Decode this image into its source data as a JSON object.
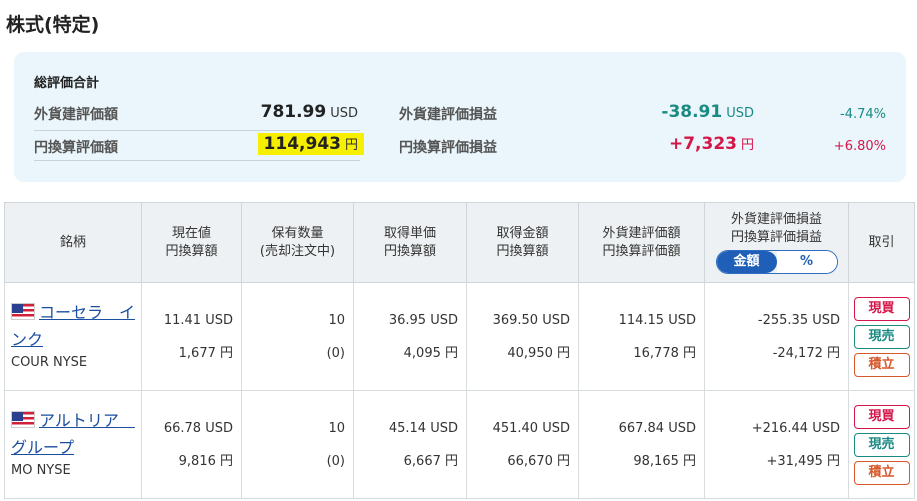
{
  "page_title": "株式(特定)",
  "summary": {
    "heading": "総評価合計",
    "foreign_value_label": "外貨建評価額",
    "foreign_value": "781.99",
    "foreign_value_unit": "USD",
    "yen_value_label": "円換算評価額",
    "yen_value": "114,943",
    "yen_value_unit": "円",
    "foreign_pl_label": "外貨建評価損益",
    "foreign_pl": "-38.91",
    "foreign_pl_unit": "USD",
    "foreign_pl_pct": "-4.74%",
    "yen_pl_label": "円換算評価損益",
    "yen_pl": "+7,323",
    "yen_pl_unit": "円",
    "yen_pl_pct": "+6.80%"
  },
  "table": {
    "headers": {
      "name": "銘柄",
      "price_1": "現在値",
      "price_2": "円換算額",
      "qty_1": "保有数量",
      "qty_2": "(売却注文中)",
      "unit_cost_1": "取得単価",
      "unit_cost_2": "円換算額",
      "cost_1": "取得金額",
      "cost_2": "円換算額",
      "value_1": "外貨建評価額",
      "value_2": "円換算評価額",
      "pl_1": "外貨建評価損益",
      "pl_2": "円換算評価損益",
      "toggle_amount": "金額",
      "toggle_pct": "%",
      "trade": "取引"
    },
    "rows": [
      {
        "name": "コーセラ　インク",
        "code": "COUR NYSE",
        "price_usd": "11.41 USD",
        "price_jpy": "1,677 円",
        "qty": "10",
        "qty_selling": "(0)",
        "unit_cost_usd": "36.95 USD",
        "unit_cost_jpy": "4,095 円",
        "cost_usd": "369.50 USD",
        "cost_jpy": "40,950 円",
        "value_usd": "114.15 USD",
        "value_jpy": "16,778 円",
        "pl_usd": "-255.35 USD",
        "pl_jpy": "-24,172 円",
        "sign": "neg",
        "btn_buy": "現買",
        "btn_sell": "現売",
        "btn_accum": "積立"
      },
      {
        "name": "アルトリア　グループ",
        "code": "MO NYSE",
        "price_usd": "66.78 USD",
        "price_jpy": "9,816 円",
        "qty": "10",
        "qty_selling": "(0)",
        "unit_cost_usd": "45.14 USD",
        "unit_cost_jpy": "6,667 円",
        "cost_usd": "451.40 USD",
        "cost_jpy": "66,670 円",
        "value_usd": "667.84 USD",
        "value_jpy": "98,165 円",
        "pl_usd": "+216.44 USD",
        "pl_jpy": "+31,495 円",
        "sign": "pos",
        "btn_buy": "現買",
        "btn_sell": "現売",
        "btn_accum": "積立"
      }
    ]
  },
  "colors": {
    "negative": "#1a8a83",
    "positive": "#d4174a",
    "highlight": "#f6f000",
    "summary_bg": "#eaf6fb",
    "link": "#1b4ea0"
  }
}
